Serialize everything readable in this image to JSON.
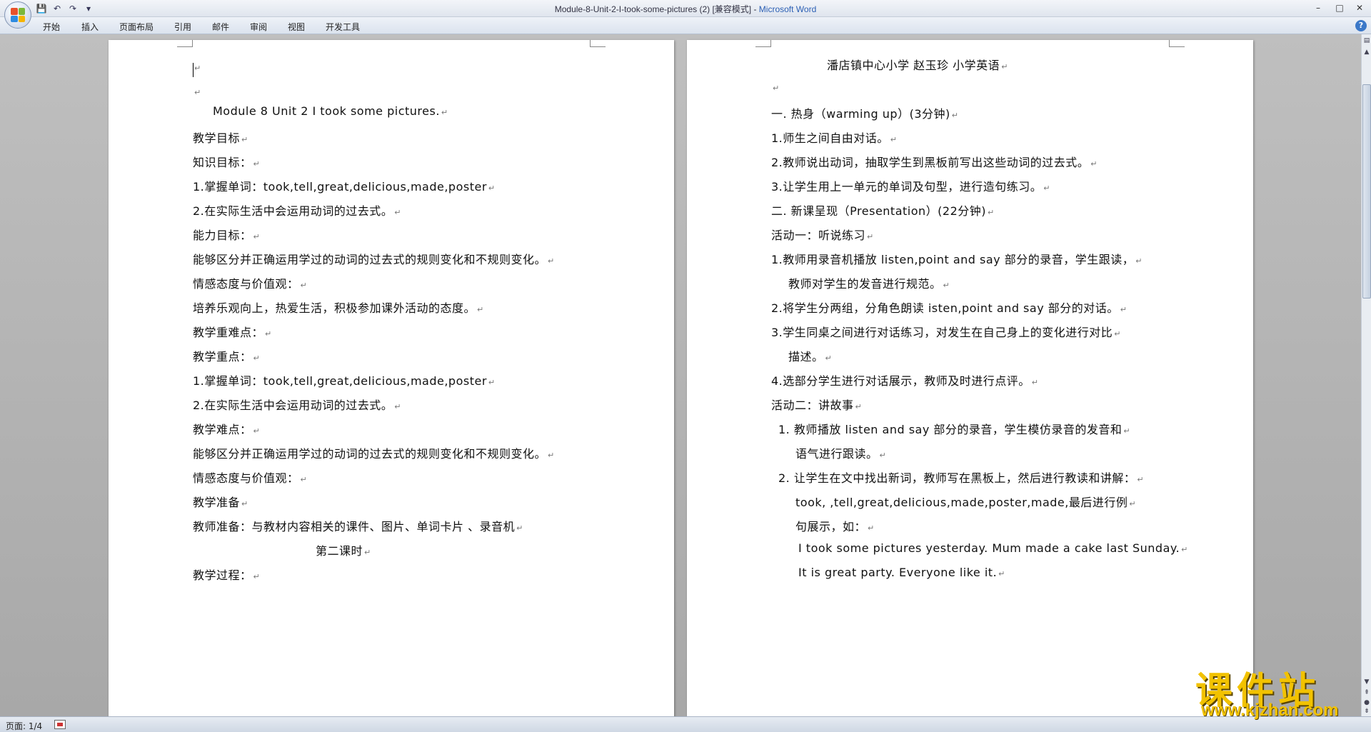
{
  "window": {
    "title_doc": "Module-8-Unit-2-I-took-some-pictures (2) [兼容模式] - ",
    "title_app": "Microsoft Word",
    "minimize": "–",
    "maximize": "□",
    "close": "✕"
  },
  "ribbon": {
    "tabs": [
      "开始",
      "插入",
      "页面布局",
      "引用",
      "邮件",
      "审阅",
      "视图",
      "开发工具"
    ],
    "help": "?"
  },
  "quick_access": {
    "icons": [
      "save-icon",
      "undo-icon",
      "redo-icon",
      "customize-icon"
    ]
  },
  "page_left": {
    "lines": [
      "",
      "",
      "Module 8 Unit 2 I took some pictures.",
      "教学目标",
      "知识目标：",
      "1.掌握单词：took,tell,great,delicious,made,poster",
      "2.在实际生活中会运用动词的过去式。",
      "能力目标：",
      "能够区分并正确运用学过的动词的过去式的规则变化和不规则变化。",
      "情感态度与价值观：",
      "培养乐观向上，热爱生活，积极参加课外活动的态度。",
      "教学重难点：",
      "教学重点：",
      "1.掌握单词：took,tell,great,delicious,made,poster",
      "2.在实际生活中会运用动词的过去式。",
      "教学难点：",
      "能够区分并正确运用学过的动词的过去式的规则变化和不规则变化。",
      "情感态度与价值观：",
      "教学准备",
      "教师准备：与教材内容相关的课件、图片、单词卡片 、录音机",
      "第二课时",
      "教学过程："
    ]
  },
  "page_right": {
    "lines": [
      "潘店镇中心小学  赵玉珍     小学英语",
      "",
      "一.  热身（warming up）(3分钟)",
      "1.师生之间自由对话。",
      "2.教师说出动词，抽取学生到黑板前写出这些动词的过去式。",
      "3.让学生用上一单元的单词及句型，进行造句练习。",
      "二.  新课呈现（Presentation）(22分钟)",
      "活动一：听说练习",
      "1.教师用录音机播放 listen,point and say 部分的录音，学生跟读，",
      "教师对学生的发音进行规范。",
      "2.将学生分两组，分角色朗读 isten,point and say 部分的对话。",
      "3.学生同桌之间进行对话练习，对发生在自己身上的变化进行对比",
      "描述。",
      "4.选部分学生进行对话展示，教师及时进行点评。",
      "活动二：讲故事",
      "1. 教师播放 listen and say 部分的录音，学生模仿录音的发音和",
      "语气进行跟读。",
      "2. 让学生在文中找出新词，教师写在黑板上，然后进行教读和讲解：",
      "took, ,tell,great,delicious,made,poster,made,最后进行例",
      "句展示，如：",
      "I took some pictures yesterday. Mum made a cake last Sunday.",
      "It is great party.  Everyone like it."
    ]
  },
  "statusbar": {
    "page": "页面: 1/4"
  },
  "watermark": {
    "cn": "课件站",
    "url": "www.kjzhan.com"
  },
  "colors": {
    "accent": "#2b5fb4",
    "watermark": "#f2c200"
  }
}
